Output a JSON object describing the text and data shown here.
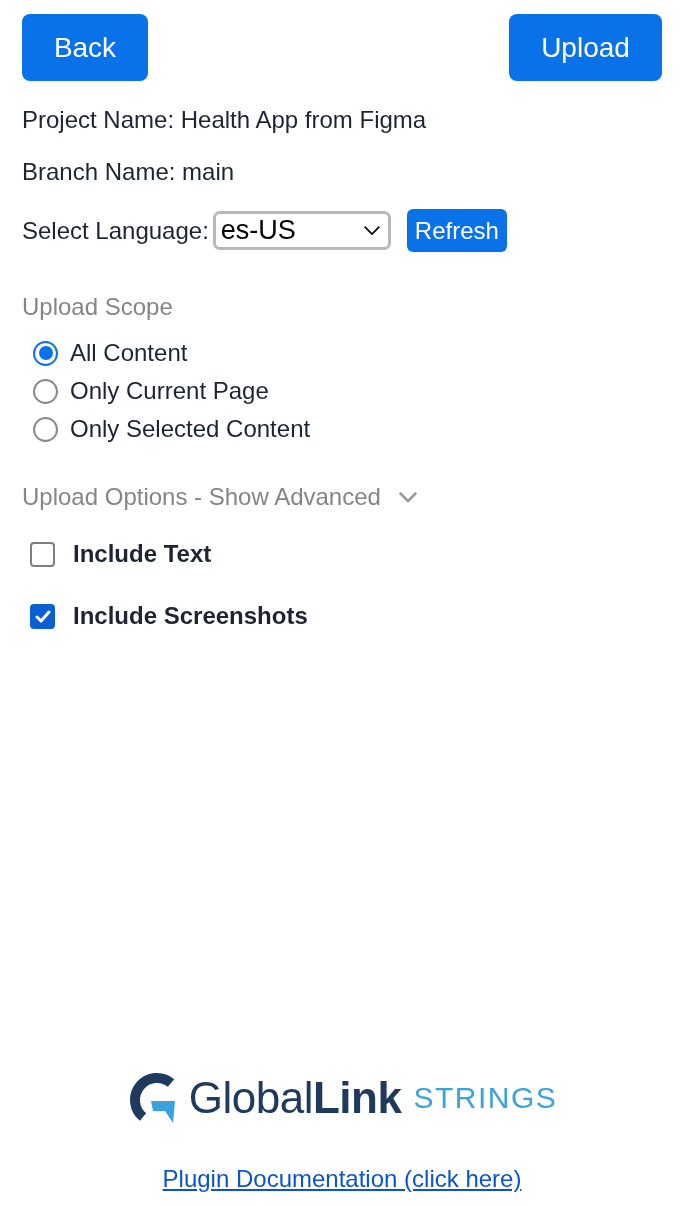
{
  "header": {
    "back_button": "Back",
    "upload_button": "Upload"
  },
  "project": {
    "project_name": "Project Name: Health App from Figma",
    "branch_name": "Branch Name: main"
  },
  "language": {
    "label": "Select Language:",
    "value": "es-US",
    "refresh_button": "Refresh"
  },
  "upload_scope": {
    "title": "Upload Scope",
    "options": [
      {
        "label": "All Content",
        "selected": true
      },
      {
        "label": "Only Current Page",
        "selected": false
      },
      {
        "label": "Only Selected Content",
        "selected": false
      }
    ]
  },
  "upload_options": {
    "title": "Upload Options - Show Advanced",
    "expanded": false,
    "items": [
      {
        "label": "Include Text",
        "checked": false
      },
      {
        "label": "Include Screenshots",
        "checked": true
      }
    ]
  },
  "footer": {
    "logo": {
      "name": "Global**Link**",
      "product": "STRINGS"
    },
    "link": "Plugin Documentation (click here)"
  }
}
